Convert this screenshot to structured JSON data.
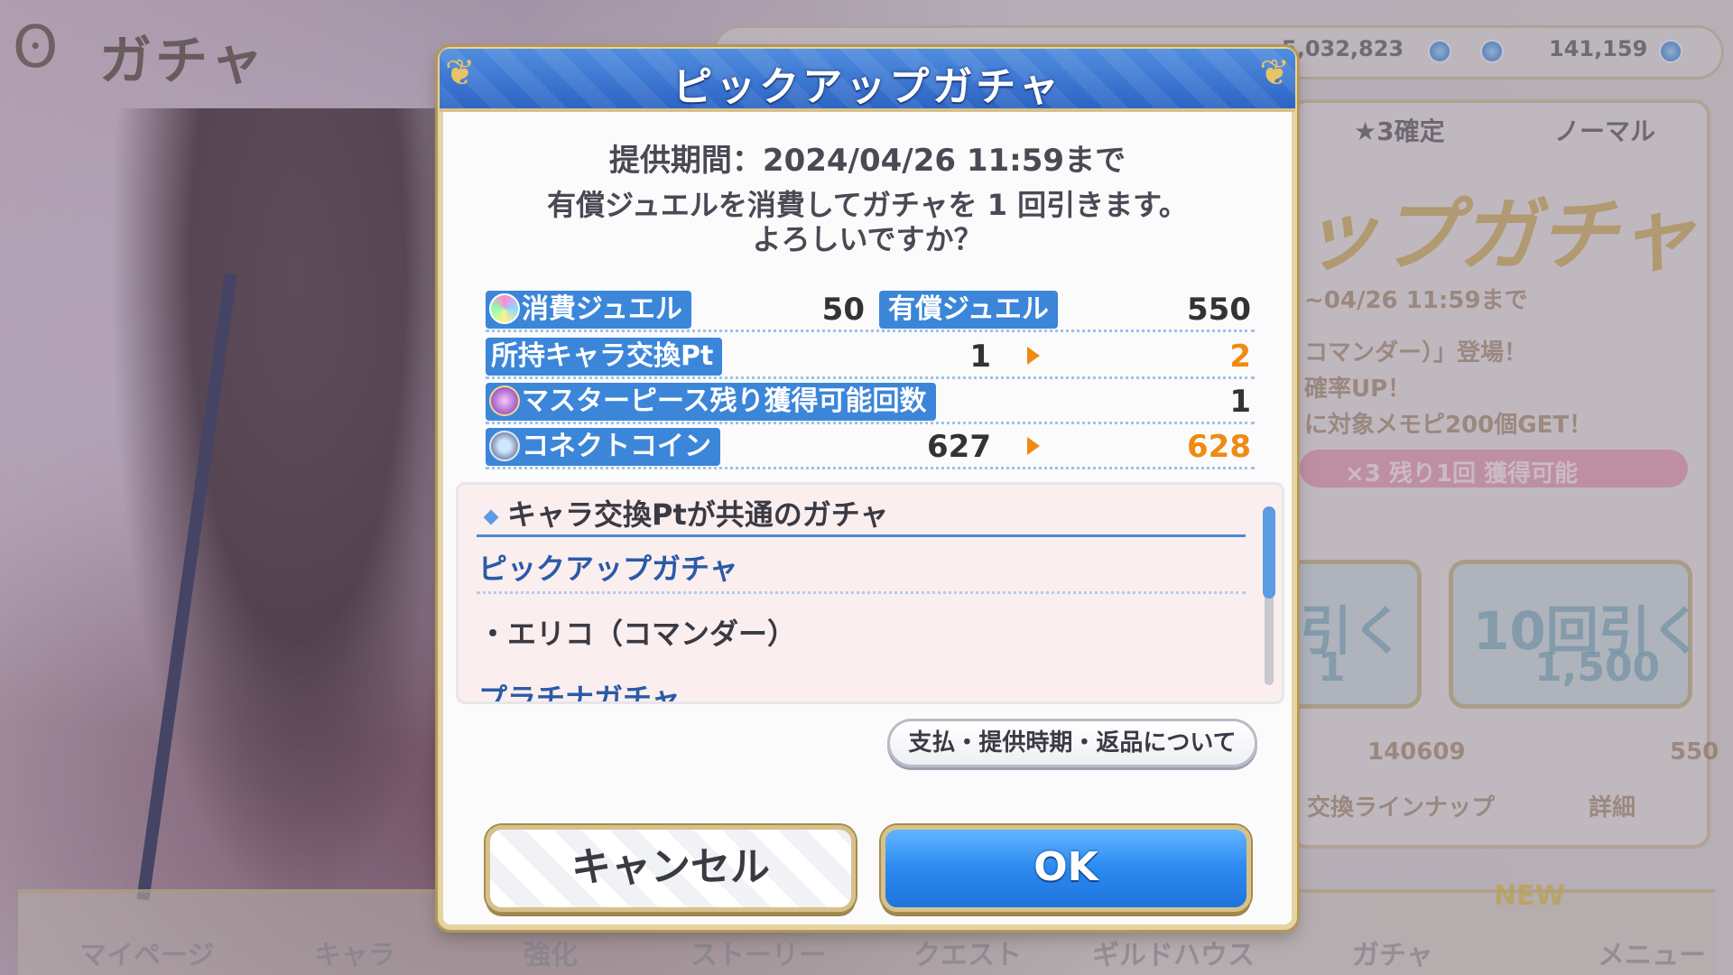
{
  "background": {
    "screen_title": "ガチャ",
    "top_counts": [
      "5,032,823",
      "141,159"
    ],
    "tabs": [
      "★3確定",
      "ノーマル"
    ],
    "banner_title": "ップガチャ",
    "banner_period": "~04/26 11:59まで",
    "banner_lines": [
      "コマンダー）」登場！",
      "確率UP！",
      "に対象メモピ200個GET！"
    ],
    "banner_pink": "×3 残り1回 獲得可能",
    "single_pull": {
      "label": "引く",
      "cost": "1"
    },
    "ten_pull": {
      "label": "10回引く",
      "cost": "1,500"
    },
    "free_jewels": "140609",
    "paid_jewels_bg": "550",
    "lineup_button": "交換ラインナップ",
    "detail_button": "詳細",
    "nav": [
      "マイページ",
      "キャラ",
      "強化",
      "ストーリー",
      "クエスト",
      "ギルドハウス",
      "ガチャ",
      "メニュー"
    ],
    "nav_new_badge": "NEW"
  },
  "dialog": {
    "title": "ピックアップガチャ",
    "period": "提供期間：2024/04/26 11:59まで",
    "confirm_line1": "有償ジュエルを消費してガチャを 1 回引きます。",
    "confirm_line2": "よろしいですか？",
    "consume_label": "消費ジュエル",
    "consume_value": "50",
    "paid_label": "有償ジュエル",
    "paid_value": "550",
    "exchange_label": "所持キャラ交換Pt",
    "exchange_before": "1",
    "exchange_after": "2",
    "masterpiece_label": "マスターピース残り獲得可能回数",
    "masterpiece_value": "1",
    "coin_label": "コネクトコイン",
    "coin_before": "627",
    "coin_after": "628",
    "list_heading": "キャラ交換Ptが共通のガチャ",
    "list_gacha_1": "ピックアップガチャ",
    "list_item_1": "・エリコ（コマンダー）",
    "list_gacha_2": "プラチナガチャ",
    "payment_button": "支払・提供時期・返品について",
    "cancel_button": "キャンセル",
    "ok_button": "OK"
  },
  "colors": {
    "header_blue": "#3a78d2",
    "pill_blue": "#3c86d9",
    "accent_orange": "#f08a12",
    "gold_border": "#d7c18b"
  }
}
